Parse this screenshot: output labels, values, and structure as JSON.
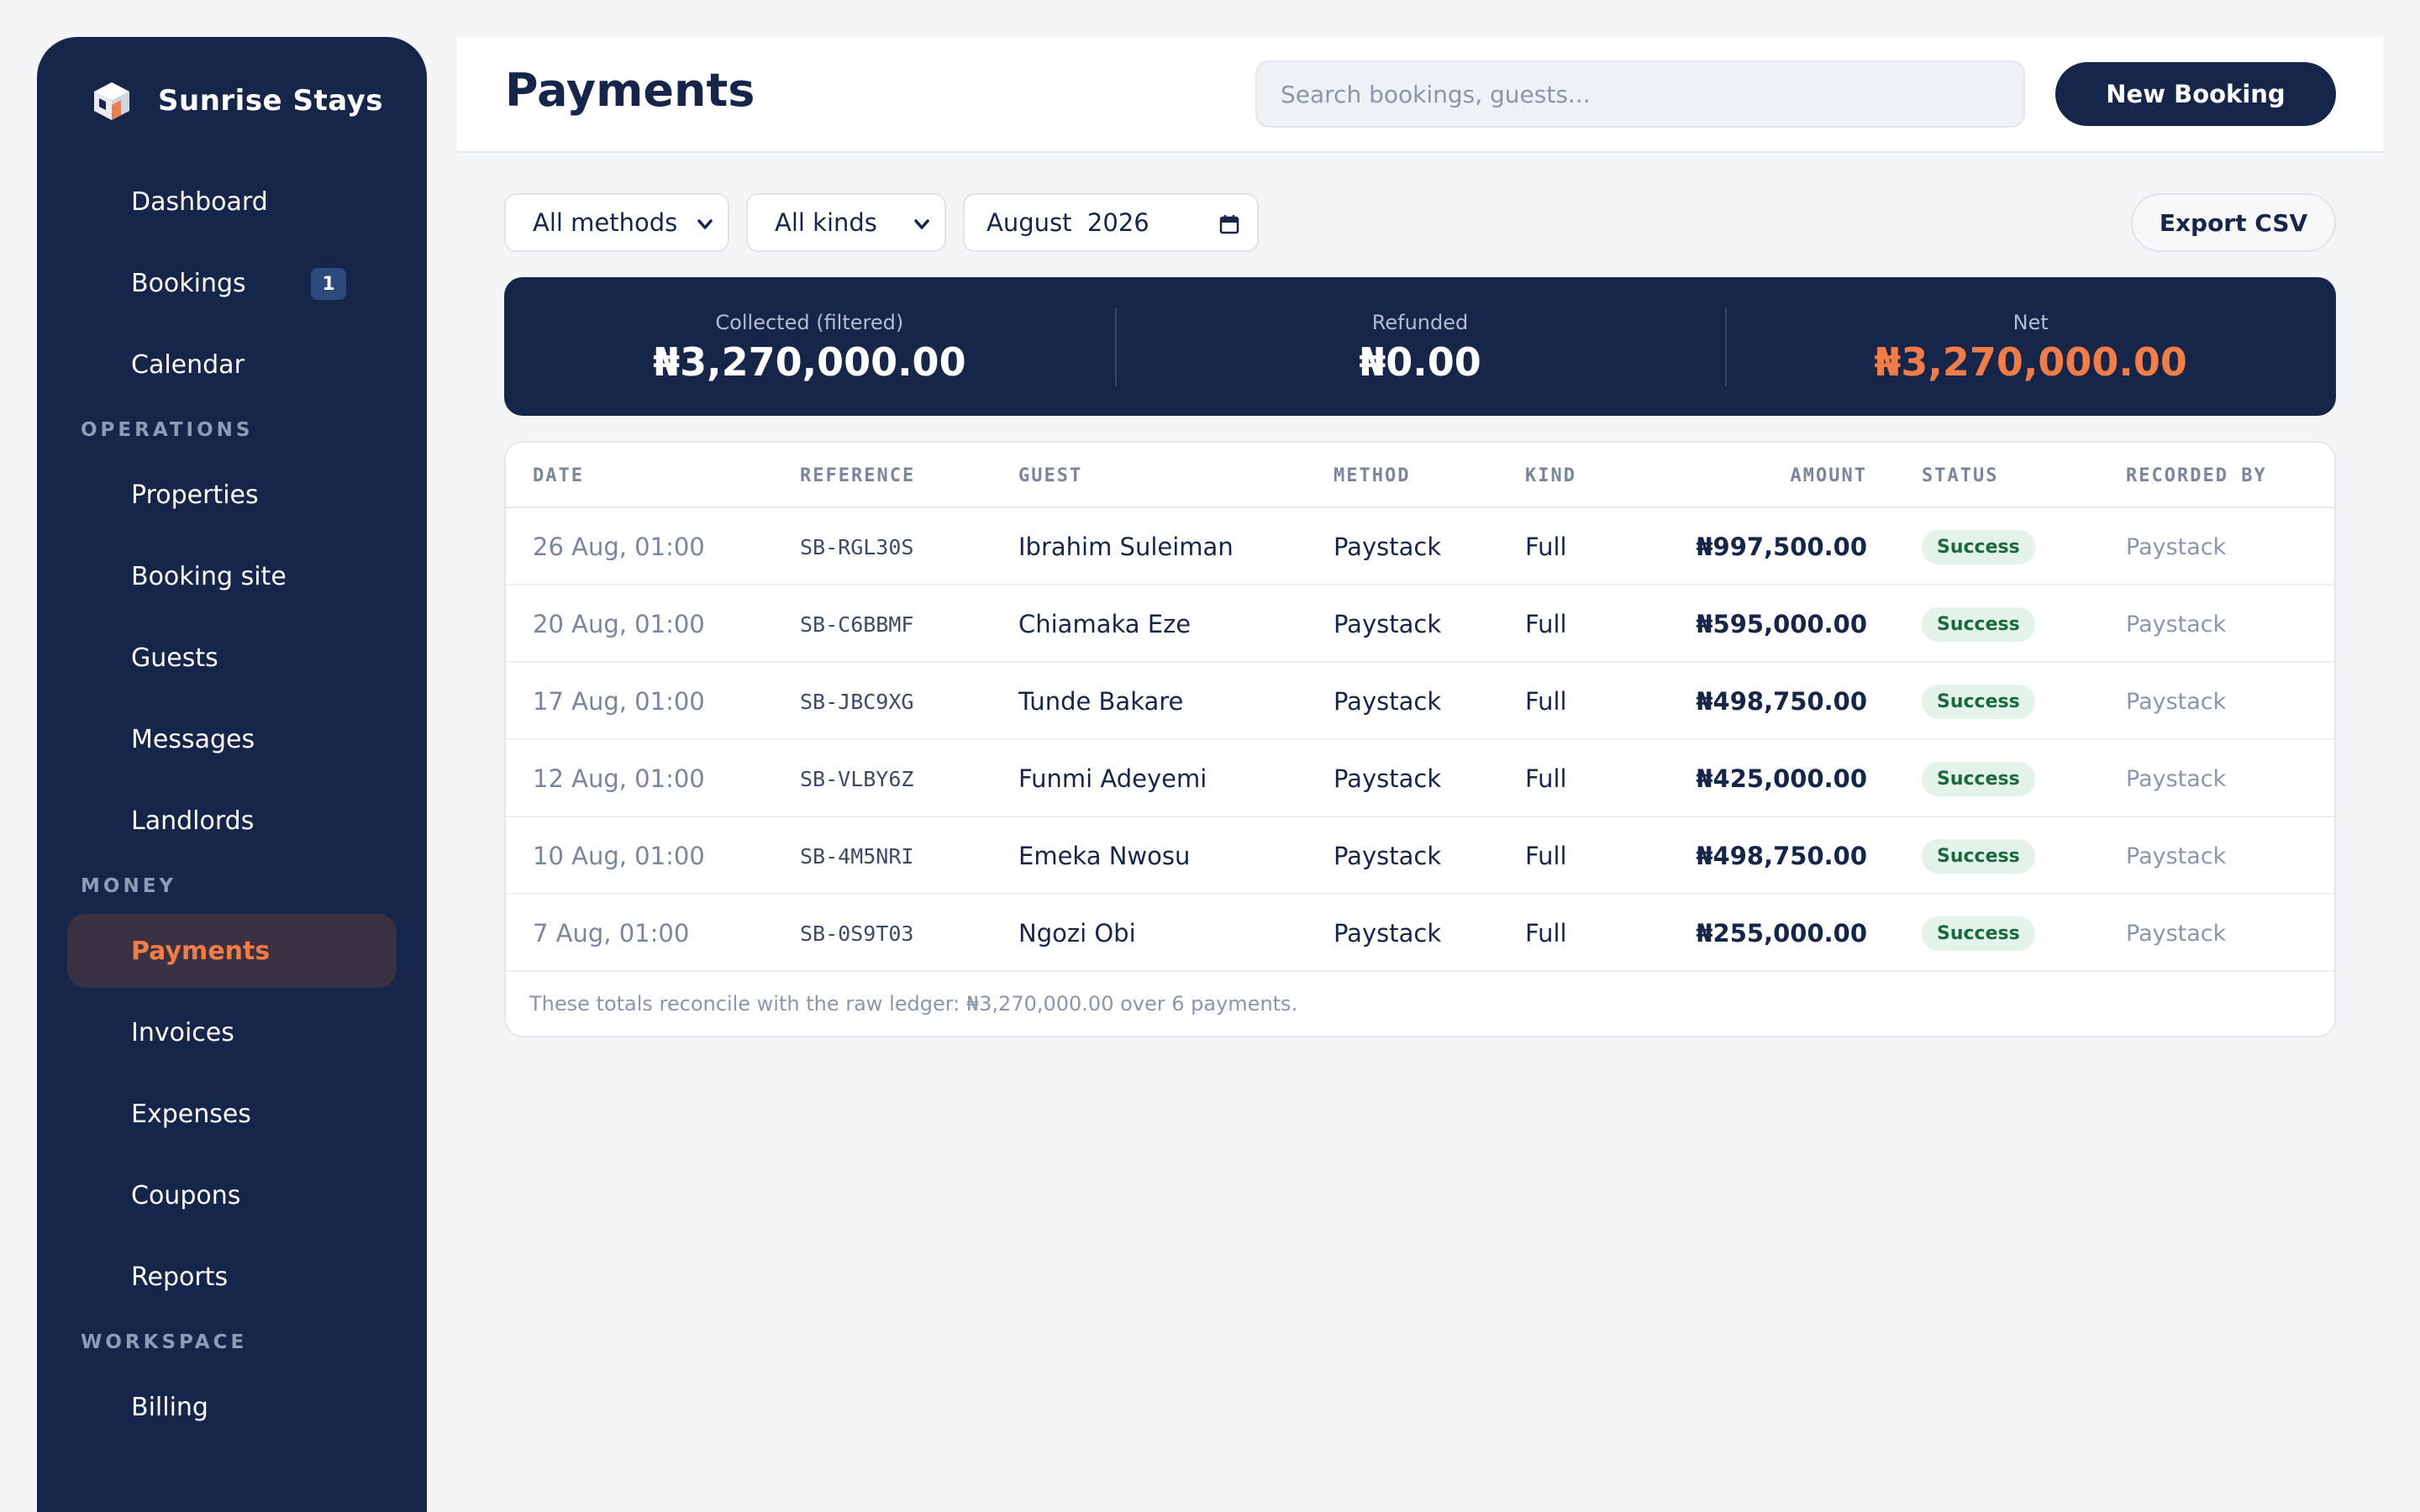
{
  "brand": {
    "name": "Sunrise Stays"
  },
  "sidebar": {
    "main": [
      {
        "label": "Dashboard"
      },
      {
        "label": "Bookings",
        "badge": "1"
      },
      {
        "label": "Calendar"
      }
    ],
    "operations_heading": "OPERATIONS",
    "operations": [
      {
        "label": "Properties"
      },
      {
        "label": "Booking site"
      },
      {
        "label": "Guests"
      },
      {
        "label": "Messages"
      },
      {
        "label": "Landlords"
      }
    ],
    "money_heading": "MONEY",
    "money": [
      {
        "label": "Payments",
        "active": true
      },
      {
        "label": "Invoices"
      },
      {
        "label": "Expenses"
      },
      {
        "label": "Coupons"
      },
      {
        "label": "Reports"
      }
    ],
    "workspace_heading": "WORKSPACE",
    "workspace": [
      {
        "label": "Billing"
      }
    ]
  },
  "header": {
    "title": "Payments",
    "search_placeholder": "Search bookings, guests...",
    "new_booking_label": "New Booking"
  },
  "filters": {
    "method": "All methods",
    "kind": "All kinds",
    "month": "August  2026",
    "export_label": "Export CSV"
  },
  "summary": {
    "collected_label": "Collected (filtered)",
    "collected_value": "₦3,270,000.00",
    "refunded_label": "Refunded",
    "refunded_value": "₦0.00",
    "net_label": "Net",
    "net_value": "₦3,270,000.00"
  },
  "table": {
    "headers": {
      "date": "DATE",
      "reference": "REFERENCE",
      "guest": "GUEST",
      "method": "METHOD",
      "kind": "KIND",
      "amount": "AMOUNT",
      "status": "STATUS",
      "recorded_by": "RECORDED BY"
    },
    "rows": [
      {
        "date": "26 Aug, 01:00",
        "reference": "SB-RGL30S",
        "guest": "Ibrahim Suleiman",
        "method": "Paystack",
        "kind": "Full",
        "amount": "₦997,500.00",
        "status": "Success",
        "recorded_by": "Paystack"
      },
      {
        "date": "20 Aug, 01:00",
        "reference": "SB-C6BBMF",
        "guest": "Chiamaka Eze",
        "method": "Paystack",
        "kind": "Full",
        "amount": "₦595,000.00",
        "status": "Success",
        "recorded_by": "Paystack"
      },
      {
        "date": "17 Aug, 01:00",
        "reference": "SB-JBC9XG",
        "guest": "Tunde Bakare",
        "method": "Paystack",
        "kind": "Full",
        "amount": "₦498,750.00",
        "status": "Success",
        "recorded_by": "Paystack"
      },
      {
        "date": "12 Aug, 01:00",
        "reference": "SB-VLBY6Z",
        "guest": "Funmi Adeyemi",
        "method": "Paystack",
        "kind": "Full",
        "amount": "₦425,000.00",
        "status": "Success",
        "recorded_by": "Paystack"
      },
      {
        "date": "10 Aug, 01:00",
        "reference": "SB-4M5NRI",
        "guest": "Emeka Nwosu",
        "method": "Paystack",
        "kind": "Full",
        "amount": "₦498,750.00",
        "status": "Success",
        "recorded_by": "Paystack"
      },
      {
        "date": "7 Aug, 01:00",
        "reference": "SB-0S9T03",
        "guest": "Ngozi Obi",
        "method": "Paystack",
        "kind": "Full",
        "amount": "₦255,000.00",
        "status": "Success",
        "recorded_by": "Paystack"
      }
    ],
    "footnote": "These totals reconcile with the raw ledger: ₦3,270,000.00 over 6 payments."
  },
  "colors": {
    "navy": "#16264a",
    "accent": "#f27c45",
    "success_bg": "#e3f3ea",
    "success_text": "#1b6a3f"
  }
}
